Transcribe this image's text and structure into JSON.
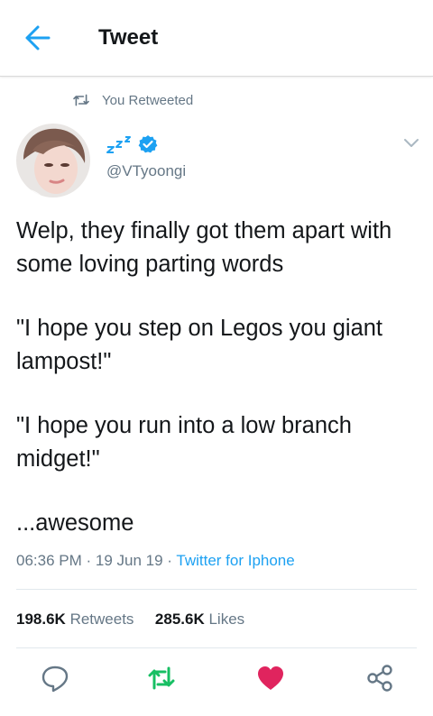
{
  "header": {
    "title": "Tweet",
    "back_icon": "arrow-left-icon"
  },
  "retweet_context": {
    "icon": "retweet-icon",
    "text": "You Retweeted"
  },
  "author": {
    "avatar": "profile-photo",
    "display_name_emoji": "zzz-sleeping-emoji",
    "verified_icon": "verified-badge-icon",
    "handle": "@VTyoongi",
    "menu_icon": "chevron-down-icon"
  },
  "tweet": {
    "paragraphs": [
      "Welp, they finally got them apart with some loving parting words",
      "\"I hope you step on Legos you giant lampost!\"",
      "\"I hope you run into a low branch midget!\"",
      "...awesome"
    ],
    "time": "06:36 PM",
    "separator": " · ",
    "date": "19 Jun 19",
    "client": "Twitter for Iphone"
  },
  "stats": {
    "retweets_count": "198.6K",
    "retweets_label": "Retweets",
    "likes_count": "285.6K",
    "likes_label": "Likes"
  },
  "actions": {
    "reply_icon": "reply-bubble-icon",
    "retweet_icon": "retweet-icon",
    "like_icon": "heart-icon",
    "share_icon": "share-icon"
  },
  "colors": {
    "accent_blue": "#1da1f2",
    "retweet_green": "#17bf63",
    "like_red": "#e0245e",
    "secondary_text": "#657786"
  }
}
